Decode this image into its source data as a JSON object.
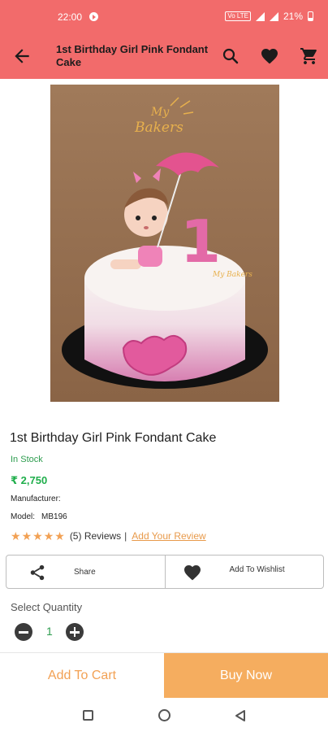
{
  "status_bar": {
    "time": "22:00",
    "battery": "21%",
    "network": "Vo LTE"
  },
  "app_bar": {
    "title": "1st Birthday Girl Pink Fondant Cake"
  },
  "image": {
    "logo_text_top": "My",
    "logo_text_bottom": "Bakers",
    "watermark": "My Bakers",
    "topper_number": "1"
  },
  "product": {
    "name": "1st Birthday Girl Pink Fondant Cake",
    "stock_status": "In Stock",
    "price": "₹ 2,750",
    "manufacturer_label": "Manufacturer:",
    "manufacturer_value": "",
    "model_label": "Model:",
    "model_value": "MB196",
    "rating": 5,
    "rating_max": 5,
    "reviews_text": "(5) Reviews",
    "separator": "|",
    "add_review_label": "Add Your Review"
  },
  "actions": {
    "share_label": "Share",
    "wishlist_label": "Add To Wishlist"
  },
  "quantity": {
    "label": "Select Quantity",
    "value": "1"
  },
  "buttons": {
    "add_to_cart": "Add To Cart",
    "buy_now": "Buy Now"
  },
  "colors": {
    "brand": "#f26b6b",
    "accent": "#f5ad5f",
    "in_stock": "#2e9d4f",
    "star": "#f2a154"
  },
  "icons": {
    "back": "arrow-left-icon",
    "search": "search-icon",
    "wishlist": "heart-icon",
    "cart": "cart-icon",
    "share": "share-icon",
    "minus": "minus-circle-icon",
    "plus": "plus-circle-icon"
  }
}
